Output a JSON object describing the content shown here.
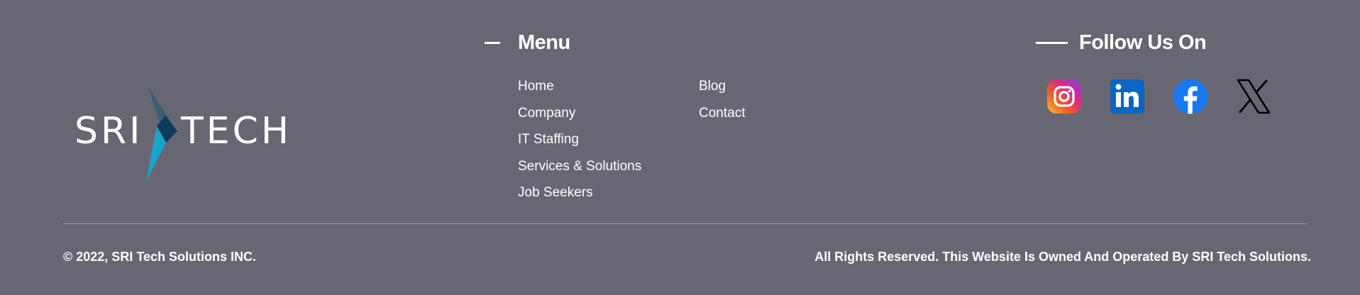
{
  "logo": {
    "text_left": "SRI",
    "text_right": "TECH",
    "colors": {
      "arrow_top": "#3d5d76",
      "arrow_mid": "#0f3b5a",
      "arrow_bottom": "#1aa3cc"
    }
  },
  "menu": {
    "heading": "Menu",
    "column1": [
      "Home",
      "Company",
      "IT Staffing",
      "Services & Solutions",
      "Job Seekers"
    ],
    "column2": [
      "Blog",
      "Contact"
    ]
  },
  "follow": {
    "heading": "Follow Us On",
    "icons": [
      "instagram-icon",
      "linkedin-icon",
      "facebook-icon",
      "x-icon"
    ]
  },
  "bottom": {
    "copyright": "© 2022, SRI Tech Solutions INC.",
    "rights": "All Rights Reserved. This Website Is Owned And Operated By SRI Tech Solutions."
  },
  "colors": {
    "background": "#676773",
    "text": "#ffffff",
    "divider": "#9a9aa4"
  }
}
